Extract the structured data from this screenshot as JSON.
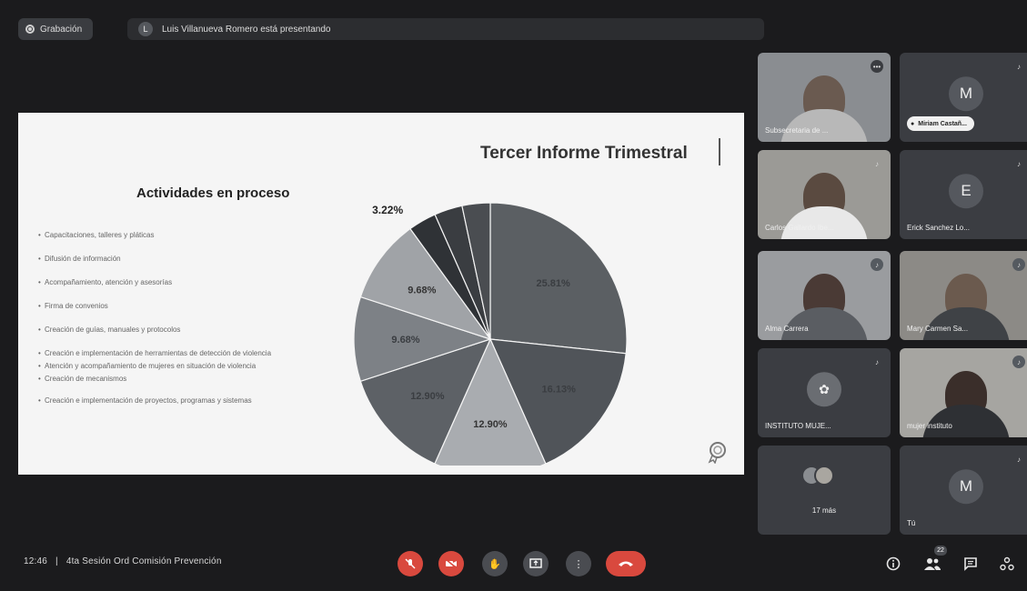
{
  "top": {
    "recording_label": "Grabación",
    "presenter_initial": "L",
    "presenter_text": "Luis Villanueva Romero está presentando"
  },
  "slide": {
    "title": "Tercer Informe Trimestral",
    "subtitle": "Actividades en proceso",
    "legend": [
      "Capacitaciones, talleres y pláticas",
      "Difusión de información",
      "Acompañamiento, atención y asesorías",
      "Firma de convenios",
      "Creación de guías, manuales y protocolos",
      "Creación e implementación de herramientas de detección de violencia",
      "Atención y acompañamiento de mujeres en situación de violencia",
      "Creación de mecanismos",
      "Creación e implementación de proyectos, programas y sistemas"
    ]
  },
  "chart_data": {
    "type": "pie",
    "title": "",
    "slices": [
      {
        "value": 25.81,
        "label": "25.81%",
        "color": "#5b5f63"
      },
      {
        "value": 16.13,
        "label": "16.13%",
        "color": "#505459"
      },
      {
        "value": 12.9,
        "label": "12.90%",
        "color": "#a9acb0"
      },
      {
        "value": 12.9,
        "label": "12.90%",
        "color": "#5d6166"
      },
      {
        "value": 9.68,
        "label": "9.68%",
        "color": "#7d8186"
      },
      {
        "value": 9.68,
        "label": "9.68%",
        "color": "#a0a3a7"
      },
      {
        "value": 3.22,
        "label": "3.22%",
        "color": "#2f3236"
      },
      {
        "value": 3.22,
        "label": "3.22%",
        "color": "#3a3d41"
      },
      {
        "value": 3.22,
        "label": "3.22%",
        "color": "#4a4d51"
      }
    ]
  },
  "participants": {
    "t1_name": "Subsecretaria de ...",
    "t2_initial": "M",
    "t2_name": "Miriam Castañ...",
    "t3_name": "Carlos Gallardo Ibe...",
    "t4_initial": "E",
    "t4_name": "Erick Sanchez Lo...",
    "t5_name": "Alma Carrera",
    "t6_name": "Mary Carmen Sa...",
    "t7_name": "INSTITUTO MUJE...",
    "t8_name": "mujer instituto",
    "t9_name": "17 más",
    "t10_initial": "M",
    "t10_name": "Tú"
  },
  "bottom": {
    "time": "12:46",
    "separator": "|",
    "meeting_name": "4ta Sesión Ord Comisión Prevención",
    "people_count": "22"
  }
}
